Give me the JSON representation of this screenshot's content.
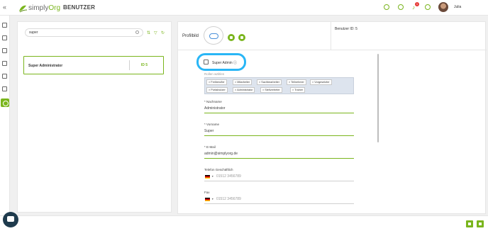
{
  "header": {
    "logo_text_prefix": "simply",
    "logo_text_suffix": "Org",
    "page_title": "BENUTZER",
    "notification_count": "1",
    "user_name": "Julia"
  },
  "list": {
    "search_value": "super",
    "items": [
      {
        "name": "Super Administrator",
        "id_label": "ID 5"
      }
    ]
  },
  "detail": {
    "profile_label": "Profilbild",
    "benutzer_id": "Benutzer ID: 5",
    "super_admin_label": "Super Admin",
    "roles_label": "Rollen wählen",
    "roles": [
      "Freiberufler",
      "Mitarbeiter",
      "Sachbearbeiter",
      "Teilnehmer",
      "Vorgesetzter",
      "Portalnutzer",
      "Administrator",
      "Stellvertreter",
      "Trainer"
    ],
    "nachname_label": "* Nachname",
    "nachname_value": "Administrator",
    "vorname_label": "* Vorname",
    "vorname_value": "Super",
    "email_label": "* E-Mail",
    "email_value": "admin@simplyorg.de",
    "telefon_label": "Telefon Geschäftlich",
    "telefon_placeholder": "01512 3456789",
    "fax_label": "Fax",
    "fax_placeholder": "01512 3456789"
  },
  "colors": {
    "accent": "#7ab51d",
    "highlight": "#29b6f6"
  }
}
